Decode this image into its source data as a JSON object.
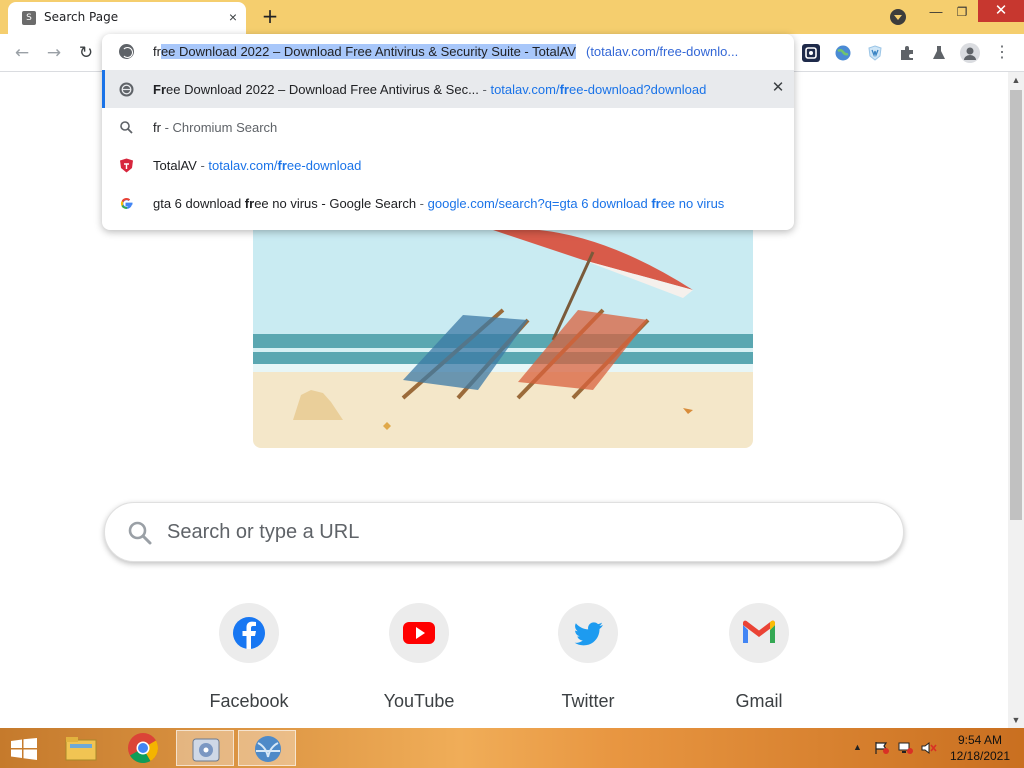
{
  "window": {
    "tab_title": "Search Page",
    "tab_favicon_letter": "S",
    "tab_close_glyph": "×",
    "new_tab_glyph": "+",
    "min_glyph": "—",
    "max_glyph": "❐",
    "close_glyph": "✕",
    "titlebar_color": "#f5ce6e",
    "close_color": "#c7372f"
  },
  "toolbar": {
    "back_glyph": "←",
    "forward_glyph": "→",
    "reload_glyph": "↻",
    "menu_glyph": "⋮",
    "extensions": [
      "qr-icon",
      "globe-extension-icon",
      "shield-extension-icon",
      "puzzle-extensions-icon",
      "lab-flask-icon",
      "profile-avatar-icon"
    ]
  },
  "omnibox": {
    "typed": "fr",
    "selected_text": "ee Download 2022 – Download Free Antivirus & Security Suite - TotalAV",
    "inline_hint": "(totalav.com/free-downlo...",
    "suggestions": [
      {
        "icon": "globe-icon",
        "title_bold": "Fr",
        "title_rest": "ee Download 2022 – Download Free Antivirus & Sec...",
        "sep": " - ",
        "url_pre": "totalav.com/",
        "url_bold": "fr",
        "url_post": "ee-download?download",
        "remove_glyph": "✕"
      },
      {
        "icon": "search-icon",
        "title": "fr",
        "sep": " - ",
        "desc": "Chromium Search"
      },
      {
        "icon": "totalav-shield-icon",
        "title": "TotalAV",
        "sep": " - ",
        "url_pre": "totalav.com/",
        "url_bold": "fr",
        "url_post": "ee-download"
      },
      {
        "icon": "google-g-icon",
        "title_pre": "gta 6 download ",
        "title_bold": "fr",
        "title_post": "ee no virus - Google Search",
        "sep": " - ",
        "url_pre": "google.com/search?q=gta 6 download ",
        "url_bold": "fr",
        "url_post": "ee no virus"
      }
    ]
  },
  "page": {
    "search_placeholder": "Search or type a URL",
    "shortcuts": [
      {
        "label": "Facebook",
        "icon": "facebook-icon"
      },
      {
        "label": "YouTube",
        "icon": "youtube-icon"
      },
      {
        "label": "Twitter",
        "icon": "twitter-icon"
      },
      {
        "label": "Gmail",
        "icon": "gmail-icon"
      }
    ]
  },
  "taskbar": {
    "time": "9:54 AM",
    "date": "12/18/2021",
    "tray_arrow": "▲",
    "apps": [
      "file-explorer-icon",
      "chrome-icon",
      "media-app-icon",
      "network-app-icon"
    ]
  }
}
